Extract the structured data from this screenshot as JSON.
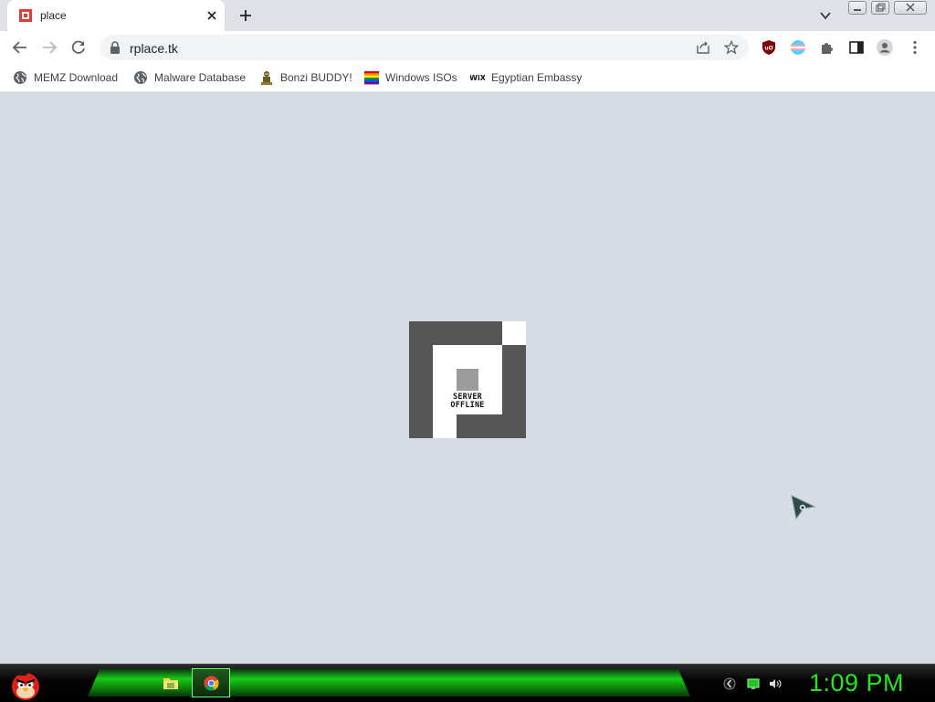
{
  "browser": {
    "tab": {
      "title": "place"
    },
    "omnibox": {
      "url": "rplace.tk"
    },
    "bookmarks": [
      {
        "label": "MEMZ Download",
        "icon": "globe-icon"
      },
      {
        "label": "Malware Database",
        "icon": "globe-icon"
      },
      {
        "label": "Bonzi BUDDY!",
        "icon": "bonzi-icon"
      },
      {
        "label": "Windows ISOs",
        "icon": "rainbow-flag-icon"
      },
      {
        "label": "Egyptian Embassy",
        "icon": "wix-icon"
      }
    ],
    "accent": "#d93025"
  },
  "page": {
    "logo_text_line1": "SERVER",
    "logo_text_line2": "OFFLINE"
  },
  "taskbar": {
    "clock": "1:09 PM",
    "clock_color": "#22e622",
    "band_color": "#18c818"
  }
}
